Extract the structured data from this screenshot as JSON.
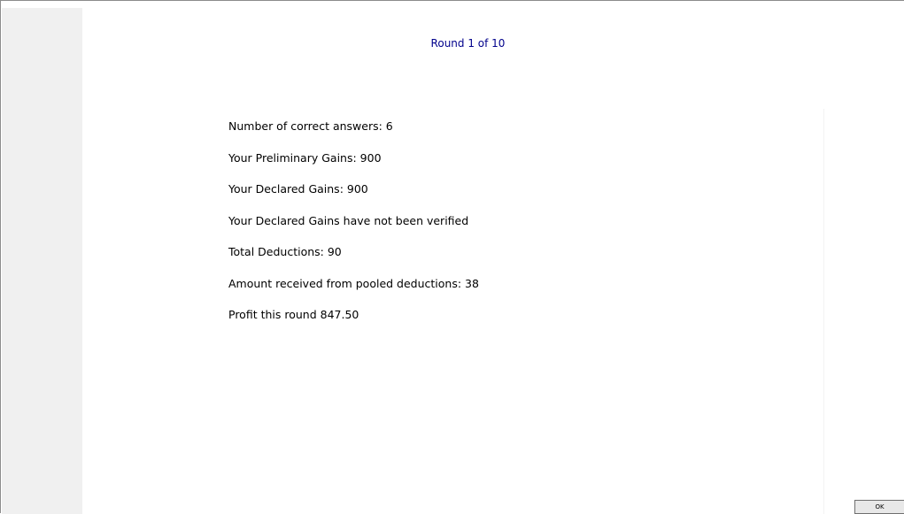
{
  "header": {
    "round_label": "Round 1 of 10"
  },
  "results": {
    "correct_answers": "Number of correct answers: 6",
    "preliminary_gains": "Your Preliminary Gains: 900",
    "declared_gains": "Your Declared Gains: 900",
    "verification_status": "Your Declared Gains have not been verified",
    "total_deductions": "Total Deductions: 90",
    "pooled_deductions_received": "Amount received from pooled deductions: 38",
    "profit": "Profit this round 847.50"
  },
  "actions": {
    "ok_label": "OK"
  },
  "colors": {
    "header_text": "#00008b",
    "sidebar_bg": "#f0f0f0",
    "page_bg": "#ffffff"
  }
}
